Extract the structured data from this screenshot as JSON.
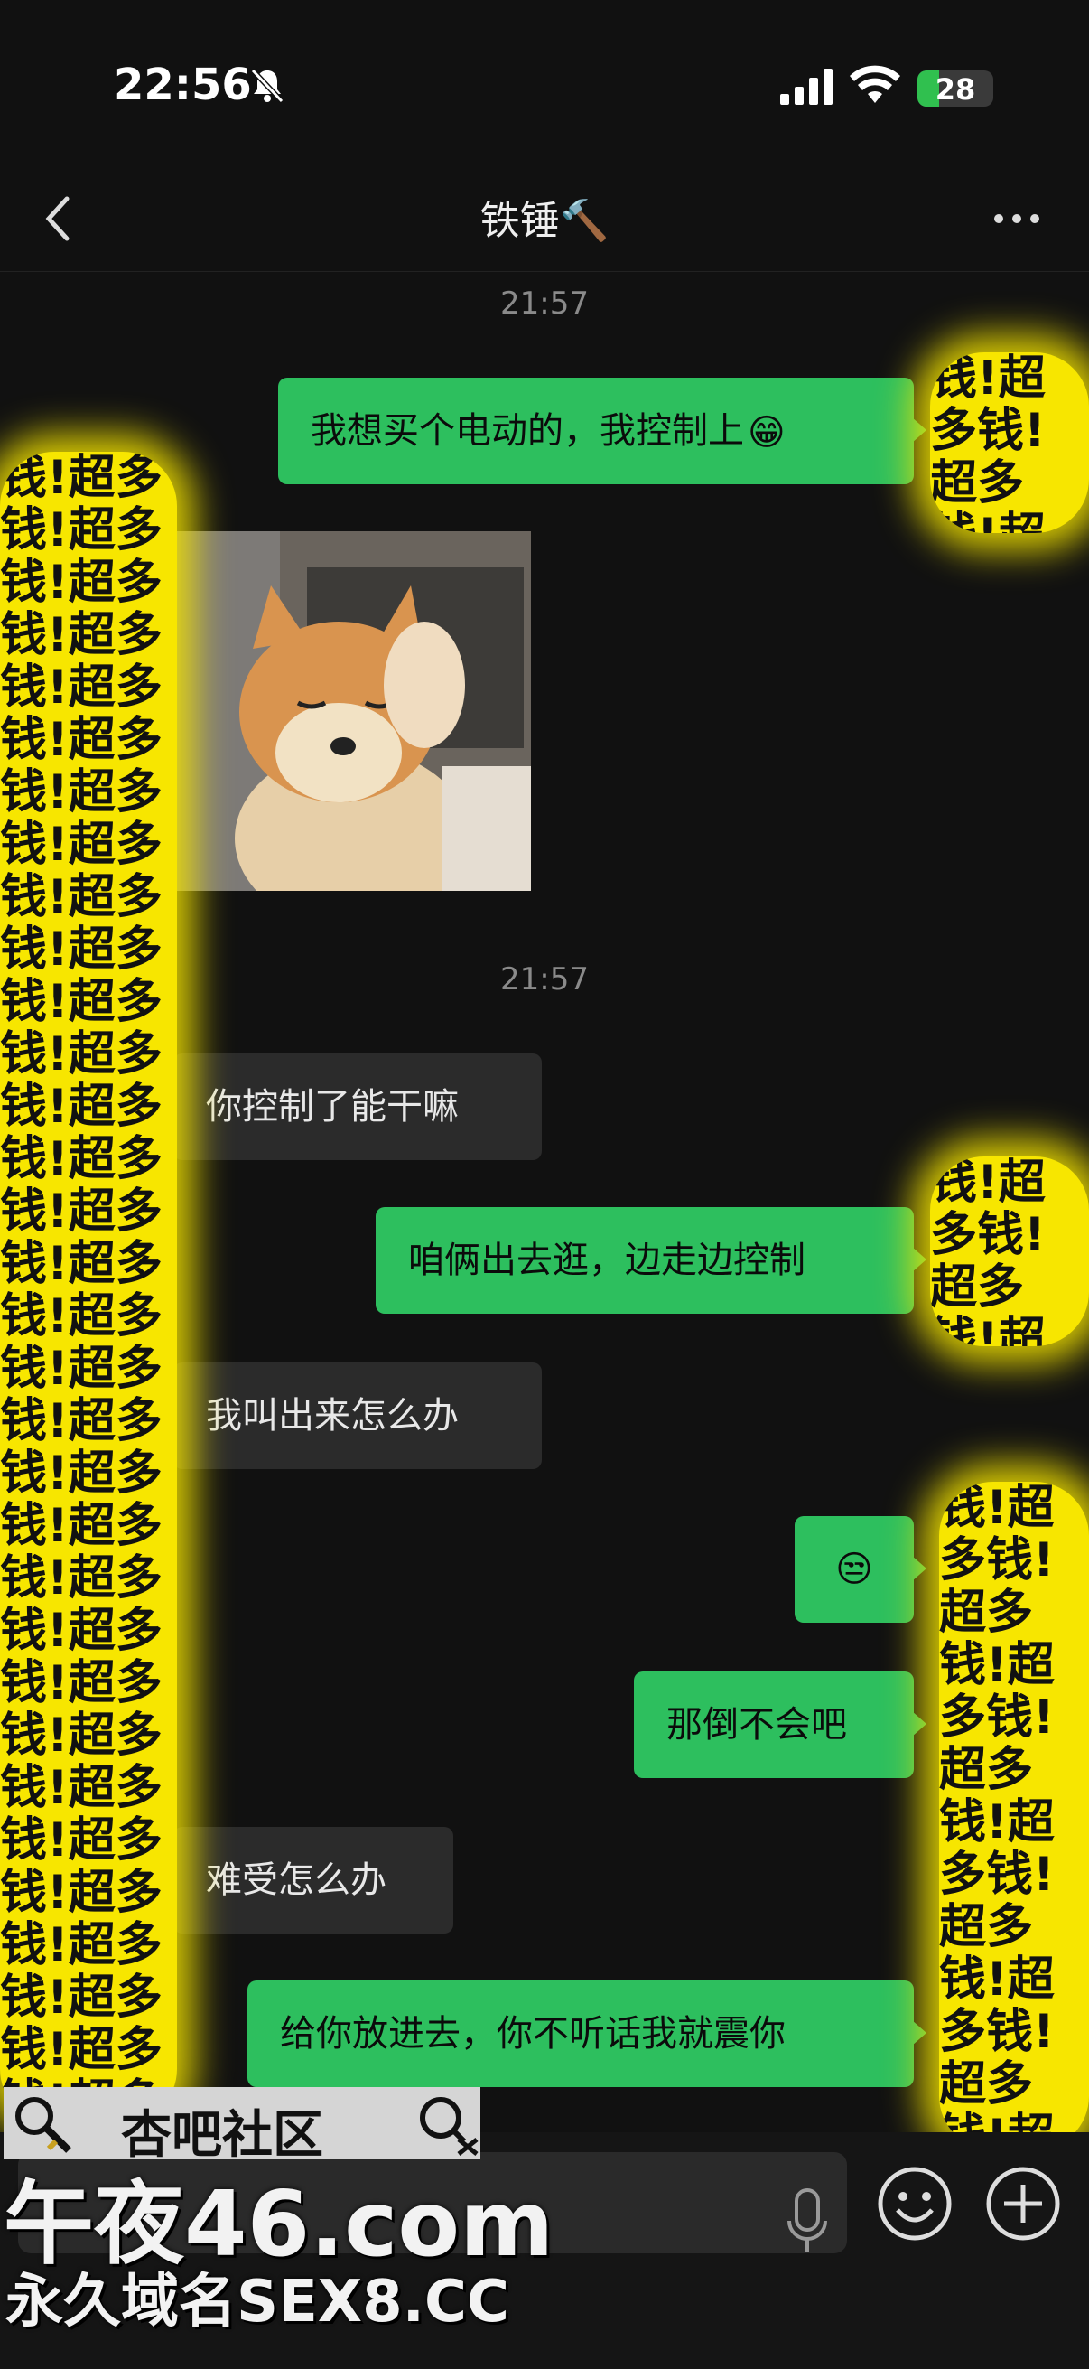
{
  "status_bar": {
    "time": "22:56",
    "battery": "28",
    "battery_level": 0.28,
    "icons": [
      "bell-slash-icon",
      "signal-icon",
      "wifi-icon",
      "battery-charging-icon"
    ]
  },
  "nav": {
    "title": "铁锤🔨",
    "back_icon": "chevron-left-icon",
    "more_icon": "more-dots-icon"
  },
  "messages": {
    "ts1": "21:57",
    "m1": "我想买个电动的，我控制上",
    "m1_emoji": "😁",
    "sticker": "shiba-inu-sticker",
    "ts2": "21:57",
    "m2": "你控制了能干嘛",
    "m3": "咱俩出去逛，边走边控制",
    "m4": "我叫出来怎么办",
    "m5_emoji": "😒",
    "m6": "那倒不会吧",
    "m7": "难受怎么办",
    "m8": "给你放进去，你不听话我就震你"
  },
  "censor_text": "钱!超多钱!超多钱!超多钱!超多钱!超多钱!超多钱!超多钱!超多钱!超多钱!超多钱!超多钱!超多钱!超多钱!超多钱!超多钱!超多钱!超多钱!超多钱!超多钱!超多钱!超多钱!超多钱!超多钱!超多钱!超多钱!超多钱!超多钱!超多钱!超多钱!超多钱!超多钱!超多钱!超多钱!超多钱!超多钱!超多钱!超多钱!超多钱!超多钱!超多钱!超多钱!超多钱!超多钱!超多钱!超多钱!超多钱!超多钱!超多钱!超多",
  "input_bar": {
    "mic_icon": "microphone-icon",
    "emoji_icon": "smiley-icon",
    "plus_icon": "plus-circle-icon"
  },
  "watermark": {
    "box_title": "杏吧社区",
    "main": "午夜46.com",
    "sub": "永久域名SEX8.CC"
  },
  "colors": {
    "bg": "#111111",
    "me_bubble": "#2dbf5e",
    "them_bubble": "#2b2b2b",
    "censor": "#f7e600"
  }
}
